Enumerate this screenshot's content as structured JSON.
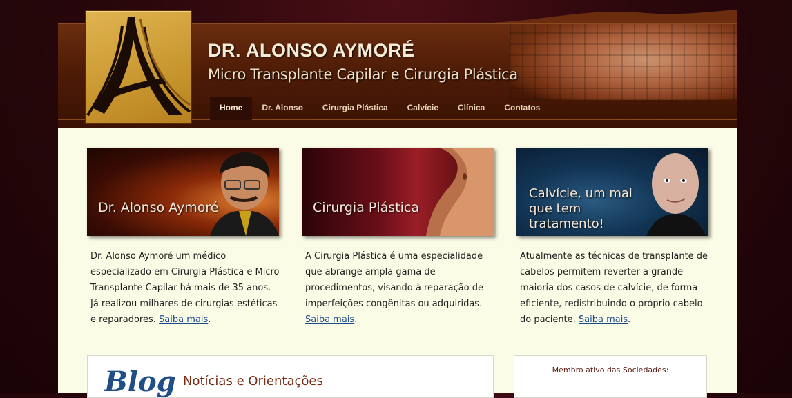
{
  "header": {
    "title": "DR. ALONSO AYMORÉ",
    "subtitle": "Micro Transplante Capilar e Cirurgia Plástica"
  },
  "nav": {
    "items": [
      {
        "label": "Home",
        "active": true
      },
      {
        "label": "Dr. Alonso"
      },
      {
        "label": "Cirurgia Plástica"
      },
      {
        "label": "Calvície"
      },
      {
        "label": "Clínica"
      },
      {
        "label": "Contatos"
      }
    ]
  },
  "cards": [
    {
      "banner_text": "Dr. Alonso Aymoré",
      "text": "Dr. Alonso Aymoré um médico especializado em Cirurgia Plástica e Micro Transplante Capilar há mais de 35 anos. Já realizou  milhares de cirurgias estéticas e reparadores. ",
      "link": "Saiba mais"
    },
    {
      "banner_text": "Cirurgia Plástica",
      "text": "A Cirurgia Plástica é uma especialidade que abrange ampla gama de procedimentos, visando à reparação de imperfeições congênitas ou adquiridas. ",
      "link": "Saiba mais"
    },
    {
      "banner_text": "Calvície, um mal que tem tratamento!",
      "text": "Atualmente as técnicas de transplante de cabelos permitem reverter a grande maioria dos casos de calvície, de forma eficiente, redistribuindo o próprio cabelo do paciente. ",
      "link": "Saiba mais"
    }
  ],
  "blog": {
    "word": "Blog",
    "title": "Notícias e Orientações"
  },
  "member": {
    "title": "Membro ativo das Sociedades:"
  },
  "colors": {
    "background": "#2a070b",
    "header": "#4e1c06",
    "content": "#fbfce6",
    "link": "#1a4a8a",
    "accent_gold": "#c8962f"
  }
}
